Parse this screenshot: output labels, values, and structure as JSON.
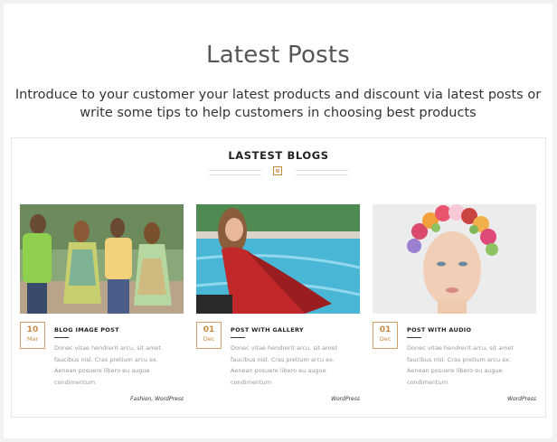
{
  "header": {
    "title": "Latest Posts",
    "intro": "Introduce to your customer your latest products and discount via latest posts or write some tips to help customers in choosing best products"
  },
  "blogs": {
    "section_title": "LASTEST BLOGS",
    "posts": [
      {
        "day": "10",
        "month": "Mar",
        "title": "BLOG IMAGE POST",
        "excerpt": "Donec vitae hendrerit arcu, sit amet faucibus nisl. Cras pretium arcu ex. Aenean posuere libero eu augue condimentum",
        "tags": "Fashion, WordPress"
      },
      {
        "day": "01",
        "month": "Dec",
        "title": "POST WITH GALLERY",
        "excerpt": "Donec vitae hendrerit arcu, sit amet faucibus nisl. Cras pretium arcu ex. Aenean posuere libero eu augue condimentum",
        "tags": "WordPress"
      },
      {
        "day": "01",
        "month": "Dec",
        "title": "POST WITH AUDIO",
        "excerpt": "Donec vitae hendrerit arcu, sit amet faucibus nisl. Cras pretium arcu ex. Aenean posuere libero eu augue condimentum",
        "tags": "WordPress"
      }
    ]
  },
  "colors": {
    "accent": "#c98a3e",
    "text": "#333333",
    "muted": "#999999"
  }
}
